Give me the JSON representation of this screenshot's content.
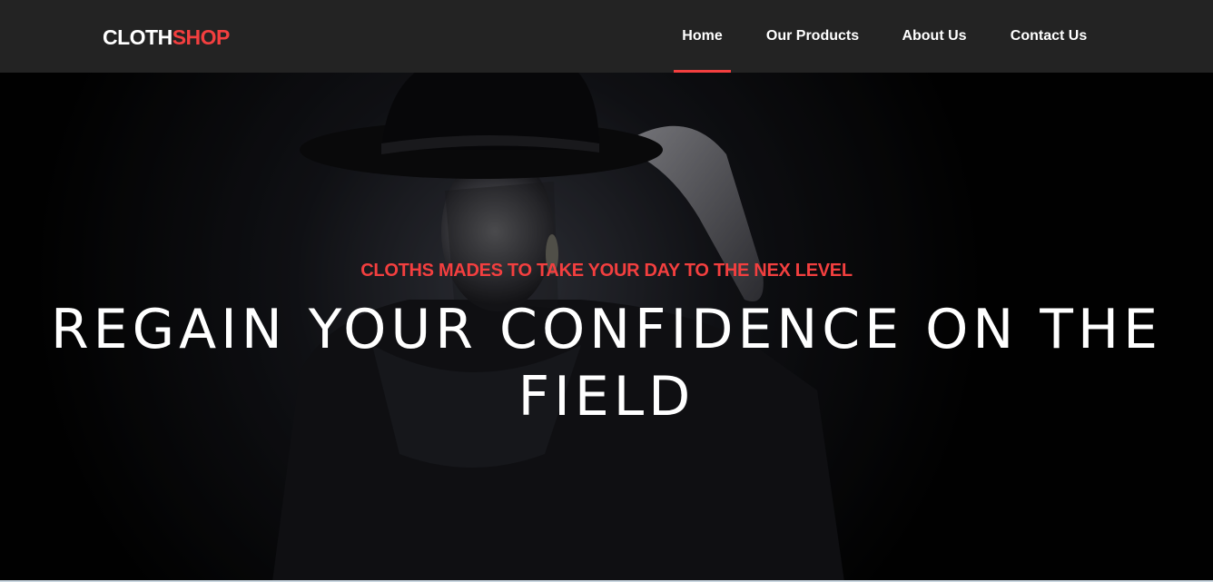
{
  "brand": {
    "part1": "CLOTH",
    "part2": "SHOP"
  },
  "nav": {
    "items": [
      {
        "label": "Home",
        "active": true
      },
      {
        "label": "Our Products",
        "active": false
      },
      {
        "label": "About Us",
        "active": false
      },
      {
        "label": "Contact Us",
        "active": false
      }
    ]
  },
  "hero": {
    "subtitle": "CLOTHS MADES TO TAKE YOUR DAY TO THE NEX LEVEL",
    "headline": "REGAIN YOUR CONFIDENCE ON THE FIELD"
  },
  "colors": {
    "accent": "#f33f3f",
    "navbar_bg": "#232323",
    "text": "#ffffff"
  }
}
